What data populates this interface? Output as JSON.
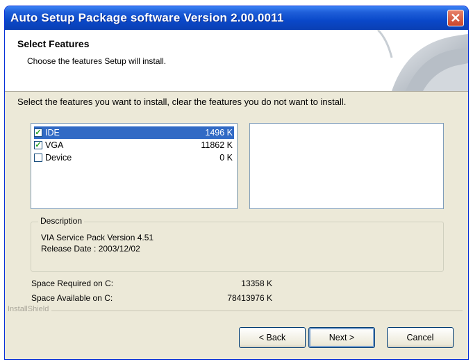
{
  "window": {
    "title": "Auto Setup Package software Version 2.00.0011",
    "close_glyph": "✕"
  },
  "header": {
    "title": "Select Features",
    "subtitle": "Choose the features Setup will install."
  },
  "instruction": "Select the features you want to install, clear the features you do not want to install.",
  "features": [
    {
      "name": "IDE",
      "size": "1496 K",
      "checked": true,
      "selected": true
    },
    {
      "name": "VGA",
      "size": "11862 K",
      "checked": true,
      "selected": false
    },
    {
      "name": "Device",
      "size": "0 K",
      "checked": false,
      "selected": false
    }
  ],
  "description": {
    "label": "Description",
    "line1": "VIA Service Pack Version 4.51",
    "line2": "Release Date : 2003/12/02"
  },
  "space": {
    "required_label": "Space Required on  C:",
    "required_value": "13358 K",
    "available_label": "Space Available on  C:",
    "available_value": "78413976 K"
  },
  "brand": "InstallShield",
  "buttons": {
    "back": "< Back",
    "next": "Next >",
    "cancel": "Cancel"
  },
  "colors": {
    "title_bar": "#0a48c9",
    "selection": "#316ac5",
    "dialog_bg": "#ece9d8"
  }
}
